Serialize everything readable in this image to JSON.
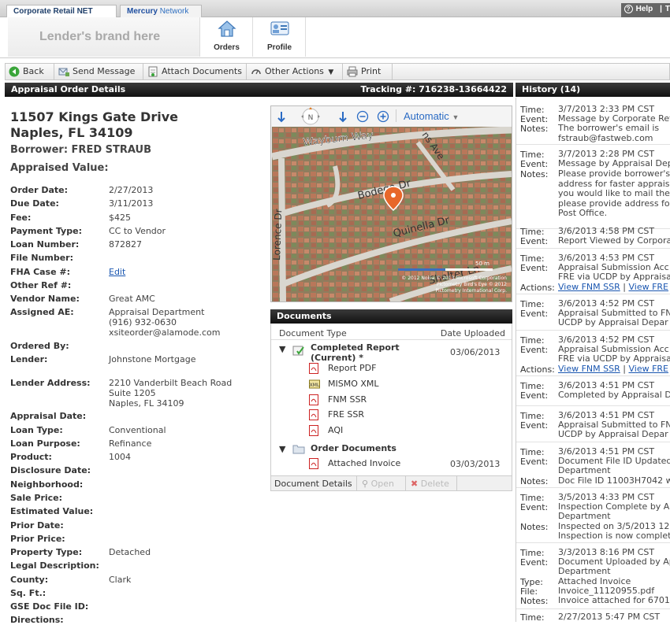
{
  "tabs": {
    "corporate": "Corporate Retail NET",
    "mercury_1": "Mercury",
    "mercury_2": "Network"
  },
  "help": {
    "help": "Help",
    "extra": "T"
  },
  "brand": "Lender's brand here",
  "nav": {
    "orders": "Orders",
    "profile": "Profile"
  },
  "toolbar": {
    "back": "Back",
    "send": "Send Message",
    "attach": "Attach Documents",
    "other": "Other Actions",
    "print": "Print"
  },
  "details": {
    "header": "Appraisal Order Details",
    "tracking": "Tracking #: 716238-13664422",
    "address_1": "11507 Kings Gate Drive",
    "address_2": "Naples, FL 34109",
    "borrower": "Borrower: FRED STRAUB",
    "appraised_value": "Appraised Value:",
    "fields": [
      {
        "label": "Order Date:",
        "value": "2/27/2013"
      },
      {
        "label": "Due Date:",
        "value": "3/11/2013"
      },
      {
        "label": "Fee:",
        "value": "$425"
      },
      {
        "label": "Payment Type:",
        "value": "CC to Vendor"
      },
      {
        "label": "Loan Number:",
        "value": "872827"
      },
      {
        "label": "File Number:",
        "value": ""
      },
      {
        "label": "FHA Case #:",
        "value": "Edit"
      },
      {
        "label": "Other Ref #:",
        "value": ""
      },
      {
        "label": "Vendor Name:",
        "value": "Great AMC"
      },
      {
        "label": "Assigned AE:",
        "value": "Appraisal Department\n(916) 932-0630\nxsiteorder@alamode.com"
      },
      {
        "label": "Ordered By:",
        "value": ""
      },
      {
        "label": "Lender:",
        "value": "Johnstone Mortgage"
      },
      {
        "label": "Lender Address:",
        "value": "2210 Vanderbilt Beach Road\nSuite 1205\nNaples, FL 34109"
      },
      {
        "label": "Appraisal Date:",
        "value": ""
      },
      {
        "label": "Loan Type:",
        "value": "Conventional"
      },
      {
        "label": "Loan Purpose:",
        "value": "Refinance"
      },
      {
        "label": "Product:",
        "value": "1004"
      },
      {
        "label": "Disclosure Date:",
        "value": ""
      },
      {
        "label": "Neighborhood:",
        "value": ""
      },
      {
        "label": "Sale Price:",
        "value": ""
      },
      {
        "label": "Estimated Value:",
        "value": ""
      },
      {
        "label": "Prior Date:",
        "value": ""
      },
      {
        "label": "Prior Price:",
        "value": ""
      },
      {
        "label": "Property Type:",
        "value": "Detached"
      },
      {
        "label": "Legal Description:",
        "value": ""
      },
      {
        "label": "County:",
        "value": "Clark"
      },
      {
        "label": "Sq. Ft.:",
        "value": ""
      },
      {
        "label": "GSE Doc File ID:",
        "value": ""
      },
      {
        "label": "Directions:",
        "value": ""
      }
    ]
  },
  "map": {
    "mode": "Automatic",
    "streets": [
      "Wayburn Way",
      "Lorence Dr",
      "Bodega Dr",
      "Quinella Dr",
      "Shelter Ln",
      "ns Ave"
    ],
    "scale": "50 m",
    "credits_1": "© 2012 Nokia   © 2013 Microsoft Corporation",
    "credits_2": "Pictometry Bird's Eye © 2012",
    "credits_3": "Pictometry International Corp."
  },
  "documents": {
    "header": "Documents",
    "col_type": "Document Type",
    "col_date": "Date Uploaded",
    "completed_1": "Completed Report",
    "completed_2": "(Current) *",
    "completed_date": "03/06/2013",
    "items": [
      "Report PDF",
      "MISMO XML",
      "FNM SSR",
      "FRE SSR",
      "AQI"
    ],
    "order_docs": "Order Documents",
    "invoice": "Attached Invoice",
    "invoice_date": "03/03/2013",
    "footer_details": "Document Details",
    "footer_open": "Open",
    "footer_delete": "Delete"
  },
  "history": {
    "header": "History (14)",
    "labels": {
      "time": "Time:",
      "event": "Event:",
      "notes": "Notes:",
      "actions": "Actions:",
      "type": "Type:",
      "file": "File:"
    },
    "e1": {
      "time": "3/7/2013 2:33 PM CST",
      "event": "Message by Corporate Ret",
      "n1": "The borrower's email is",
      "n2": "fstraub@fastweb.com"
    },
    "e2": {
      "time": "3/7/2013 2:28 PM CST",
      "event": "Message by Appraisal Dep",
      "n1": "Please provide borrower's",
      "n2": "address for faster apprais",
      "n3": "you would like to mail the",
      "n4": "please provide address fo",
      "n5": "Post Office."
    },
    "e3": {
      "time": "3/6/2013 4:58 PM CST",
      "event": "Report Viewed by Corpora"
    },
    "e4": {
      "time": "3/6/2013 4:53 PM CST",
      "event": "Appraisal Submission Acc",
      "event2": "FRE via UCDP by Appraisa",
      "a1": "View FNM SSR",
      "sep": "|",
      "a2": "View FRE"
    },
    "e5": {
      "time": "3/6/2013 4:52 PM CST",
      "event": "Appraisal Submitted to FN",
      "event2": "UCDP by Appraisal Depar"
    },
    "e6": {
      "time": "3/6/2013 4:52 PM CST",
      "event": "Appraisal Submission Acc",
      "event2": "FRE via UCDP by Appraisa",
      "a1": "View FNM SSR",
      "sep": "|",
      "a2": "View FRE"
    },
    "e7": {
      "time": "3/6/2013 4:51 PM CST",
      "event": "Completed by Appraisal D"
    },
    "e8": {
      "time": "3/6/2013 4:51 PM CST",
      "event": "Appraisal Submitted to FN",
      "event2": "UCDP by Appraisal Depar"
    },
    "e9": {
      "time": "3/6/2013 4:51 PM CST",
      "event": "Document File ID Updated",
      "event2": "Department",
      "n1": "Doc File ID 11003H7042 w"
    },
    "e10": {
      "time": "3/5/2013 4:33 PM CST",
      "event": "Inspection Complete by A",
      "event2": "Department",
      "n1": "Inspected on 3/5/2013 12",
      "n2": "Inspection is now complet"
    },
    "e11": {
      "time": "3/3/2013 8:16 PM CST",
      "event": "Document Uploaded by Ap",
      "event2": "Department",
      "type": "Attached Invoice",
      "file": "Invoice_11120955.pdf",
      "n1": "Invoice attached for 6701"
    },
    "e12": {
      "time": "2/27/2013 5:47 PM CST"
    }
  }
}
